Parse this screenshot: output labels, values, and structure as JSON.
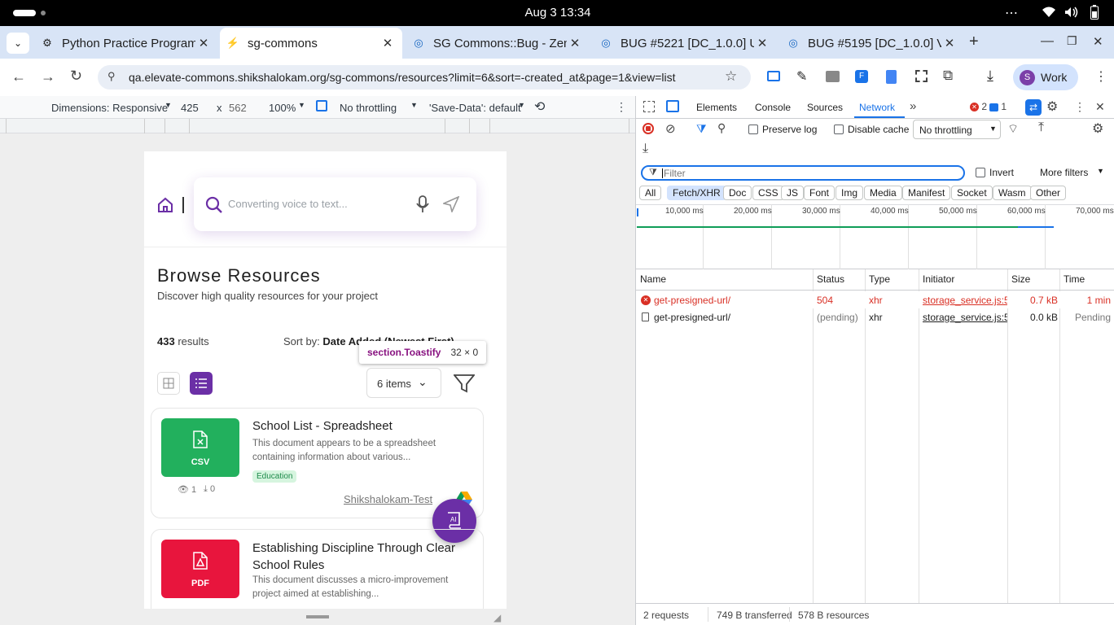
{
  "system": {
    "clock": "Aug 3  13:34"
  },
  "tabs": [
    {
      "title": "Python Practice Program",
      "active": false
    },
    {
      "title": "sg-commons",
      "active": true
    },
    {
      "title": "SG Commons::Bug - Zen",
      "active": false
    },
    {
      "title": "BUG #5221 [DC_1.0.0] U",
      "active": false
    },
    {
      "title": "BUG #5195 [DC_1.0.0] V",
      "active": false
    }
  ],
  "toolbar": {
    "url": "qa.elevate-commons.shikshalokam.org/sg-commons/resources?limit=6&sort=-created_at&page=1&view=list",
    "profile_initial": "S",
    "profile_label": "Work"
  },
  "device_toolbar": {
    "dimensions_label": "Dimensions: Responsive",
    "width": "425",
    "times": "x",
    "height": "562",
    "zoom": "100%",
    "throttling": "No throttling",
    "save_data": "'Save-Data': default"
  },
  "app": {
    "search_placeholder": "Converting voice to text...",
    "heading": "Browse Resources",
    "subheading": "Discover high quality resources for your project",
    "results_count": "433",
    "results_label": "results",
    "sort_label": "Sort by:",
    "sort_value": "Date Added (Newest First)",
    "tooltip_selector": "section.Toastify",
    "tooltip_size": "32 × 0",
    "items_select": "6 items",
    "resources": [
      {
        "file_type": "CSV",
        "color": "#22b05d",
        "title": "School List - Spreadsheet",
        "description": "This document appears to be a spreadsheet containing information about various...",
        "tag": "Education",
        "views": "1",
        "downloads": "0",
        "author": "Shikshalokam-Test"
      },
      {
        "file_type": "PDF",
        "color": "#e8153d",
        "title": "Establishing Discipline Through Clear School Rules",
        "description": "This document discusses a micro-improvement project aimed at establishing..."
      }
    ]
  },
  "devtools": {
    "tabs": [
      "Elements",
      "Console",
      "Sources",
      "Network"
    ],
    "active_tab": "Network",
    "error_count": "2",
    "message_count": "1",
    "preserve_log": "Preserve log",
    "disable_cache": "Disable cache",
    "throttling": "No throttling",
    "filter_placeholder": "Filter",
    "invert": "Invert",
    "more_filters": "More filters",
    "filter_types": [
      "All",
      "Fetch/XHR",
      "Doc",
      "CSS",
      "JS",
      "Font",
      "Img",
      "Media",
      "Manifest",
      "Socket",
      "Wasm",
      "Other"
    ],
    "active_filter": "Fetch/XHR",
    "timeline_ticks": [
      "10,000 ms",
      "20,000 ms",
      "30,000 ms",
      "40,000 ms",
      "50,000 ms",
      "60,000 ms",
      "70,000 ms"
    ],
    "columns": [
      "Name",
      "Status",
      "Type",
      "Initiator",
      "Size",
      "Time"
    ],
    "requests": [
      {
        "name": "get-presigned-url/",
        "status": "504",
        "type": "xhr",
        "initiator": "storage_service.js:5",
        "size": "0.7 kB",
        "time": "1 min",
        "error": true
      },
      {
        "name": "get-presigned-url/",
        "status": "(pending)",
        "type": "xhr",
        "initiator": "storage_service.js:5",
        "size": "0.0 kB",
        "time": "Pending",
        "error": false
      }
    ],
    "summary": {
      "requests": "2 requests",
      "transferred": "749 B transferred",
      "resources": "578 B resources"
    }
  }
}
